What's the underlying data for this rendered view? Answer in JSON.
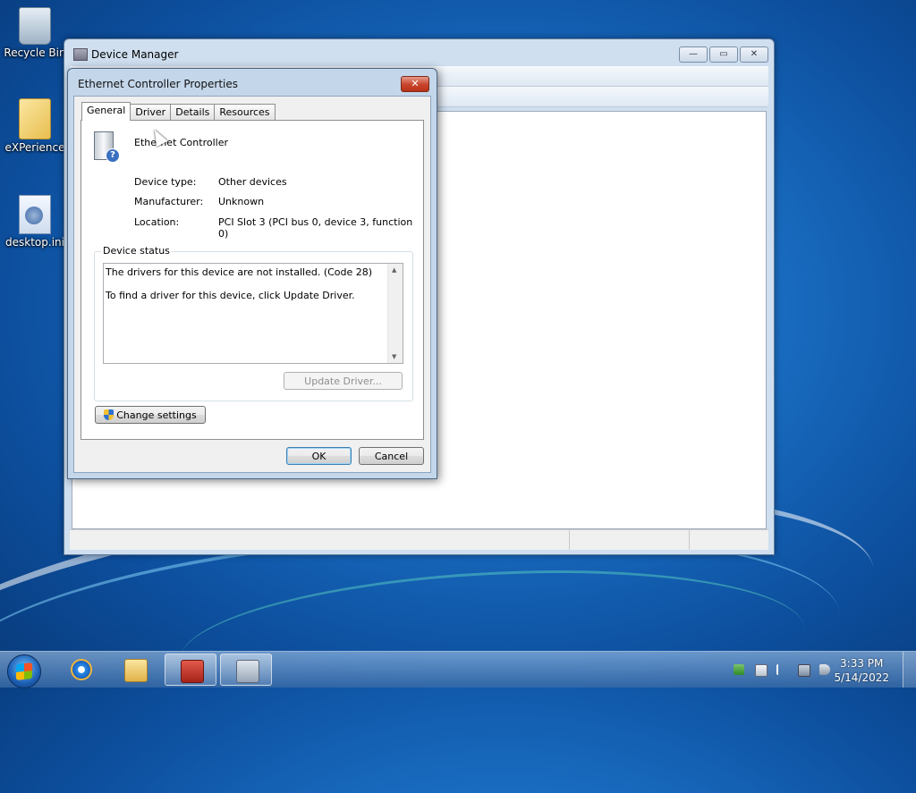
{
  "desktop": {
    "icons": [
      {
        "label": "Recycle Bin"
      },
      {
        "label": "eXPerience"
      },
      {
        "label": "desktop.ini"
      }
    ]
  },
  "device_manager": {
    "title": "Device Manager",
    "caption_buttons": {
      "minimize": "—",
      "maximize": "▭",
      "close": "✕"
    }
  },
  "dialog": {
    "title": "Ethernet Controller Properties",
    "close": "✕",
    "tabs": [
      {
        "label": "General",
        "active": true
      },
      {
        "label": "Driver",
        "active": false
      },
      {
        "label": "Details",
        "active": false
      },
      {
        "label": "Resources",
        "active": false
      }
    ],
    "device_name": "Ethernet Controller",
    "properties": [
      {
        "label": "Device type:",
        "value": "Other devices"
      },
      {
        "label": "Manufacturer:",
        "value": "Unknown"
      },
      {
        "label": "Location:",
        "value": "PCI Slot 3 (PCI bus 0, device 3, function 0)"
      }
    ],
    "status_group_label": "Device status",
    "status_lines": [
      "The drivers for this device are not installed. (Code 28)",
      "To find a driver for this device, click Update Driver."
    ],
    "update_driver_label": "Update Driver...",
    "change_settings_label": "Change settings",
    "ok_label": "OK",
    "cancel_label": "Cancel"
  },
  "taskbar": {
    "items": [
      {
        "icon": "internet-explorer-icon",
        "open": false
      },
      {
        "icon": "windows-explorer-icon",
        "open": false
      },
      {
        "icon": "toolbox-icon",
        "open": true
      },
      {
        "icon": "device-manager-icon",
        "open": true
      }
    ],
    "tray_icons": [
      "network-check-icon",
      "document-icon",
      "flag-icon",
      "network-error-icon",
      "volume-muted-icon"
    ],
    "time": "3:33 PM",
    "date": "5/14/2022"
  }
}
